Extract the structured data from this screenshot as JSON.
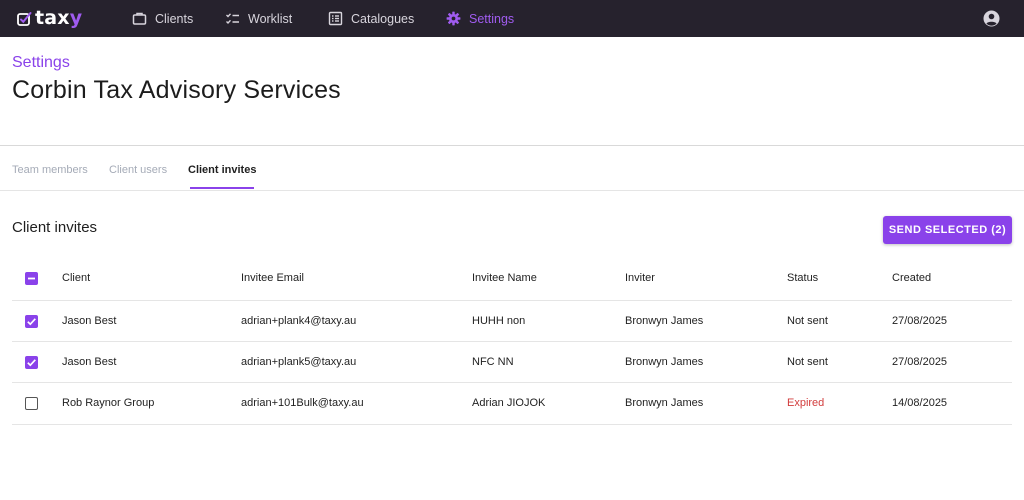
{
  "app": {
    "logo_text_main": "tax",
    "logo_text_accent": "y",
    "accent_color": "#8a42ea",
    "nav_bg": "#26222d"
  },
  "nav": {
    "items": [
      {
        "label": "Clients",
        "icon": "briefcase-icon"
      },
      {
        "label": "Worklist",
        "icon": "checklist-icon"
      },
      {
        "label": "Catalogues",
        "icon": "catalogue-icon"
      },
      {
        "label": "Settings",
        "icon": "gear-icon",
        "active": true
      }
    ],
    "account_icon": "account-circle-icon"
  },
  "header": {
    "subtitle": "Settings",
    "title": "Corbin Tax Advisory Services"
  },
  "tabs": [
    {
      "label": "Team members",
      "active": false
    },
    {
      "label": "Client users",
      "active": false
    },
    {
      "label": "Client invites",
      "active": true
    }
  ],
  "section": {
    "title": "Client invites",
    "send_button_label": "SEND SELECTED (2)"
  },
  "table": {
    "select_all_state": "indeterminate",
    "columns": [
      "Client",
      "Invitee Email",
      "Invitee Name",
      "Inviter",
      "Status",
      "Created"
    ],
    "rows": [
      {
        "checked": true,
        "client": "Jason Best",
        "email": "adrian+plank4@taxy.au",
        "invitee_name": "HUHH non",
        "inviter": "Bronwyn James",
        "status": "Not sent",
        "created": "27/08/2025"
      },
      {
        "checked": true,
        "client": "Jason Best",
        "email": "adrian+plank5@taxy.au",
        "invitee_name": "NFC NN",
        "inviter": "Bronwyn James",
        "status": "Not sent",
        "created": "27/08/2025"
      },
      {
        "checked": false,
        "client": "Rob Raynor Group",
        "email": "adrian+101Bulk@taxy.au",
        "invitee_name": "Adrian JIOJOK",
        "inviter": "Bronwyn James",
        "status": "Expired",
        "created": "14/08/2025"
      }
    ],
    "expired_color": "#d23c3c"
  }
}
